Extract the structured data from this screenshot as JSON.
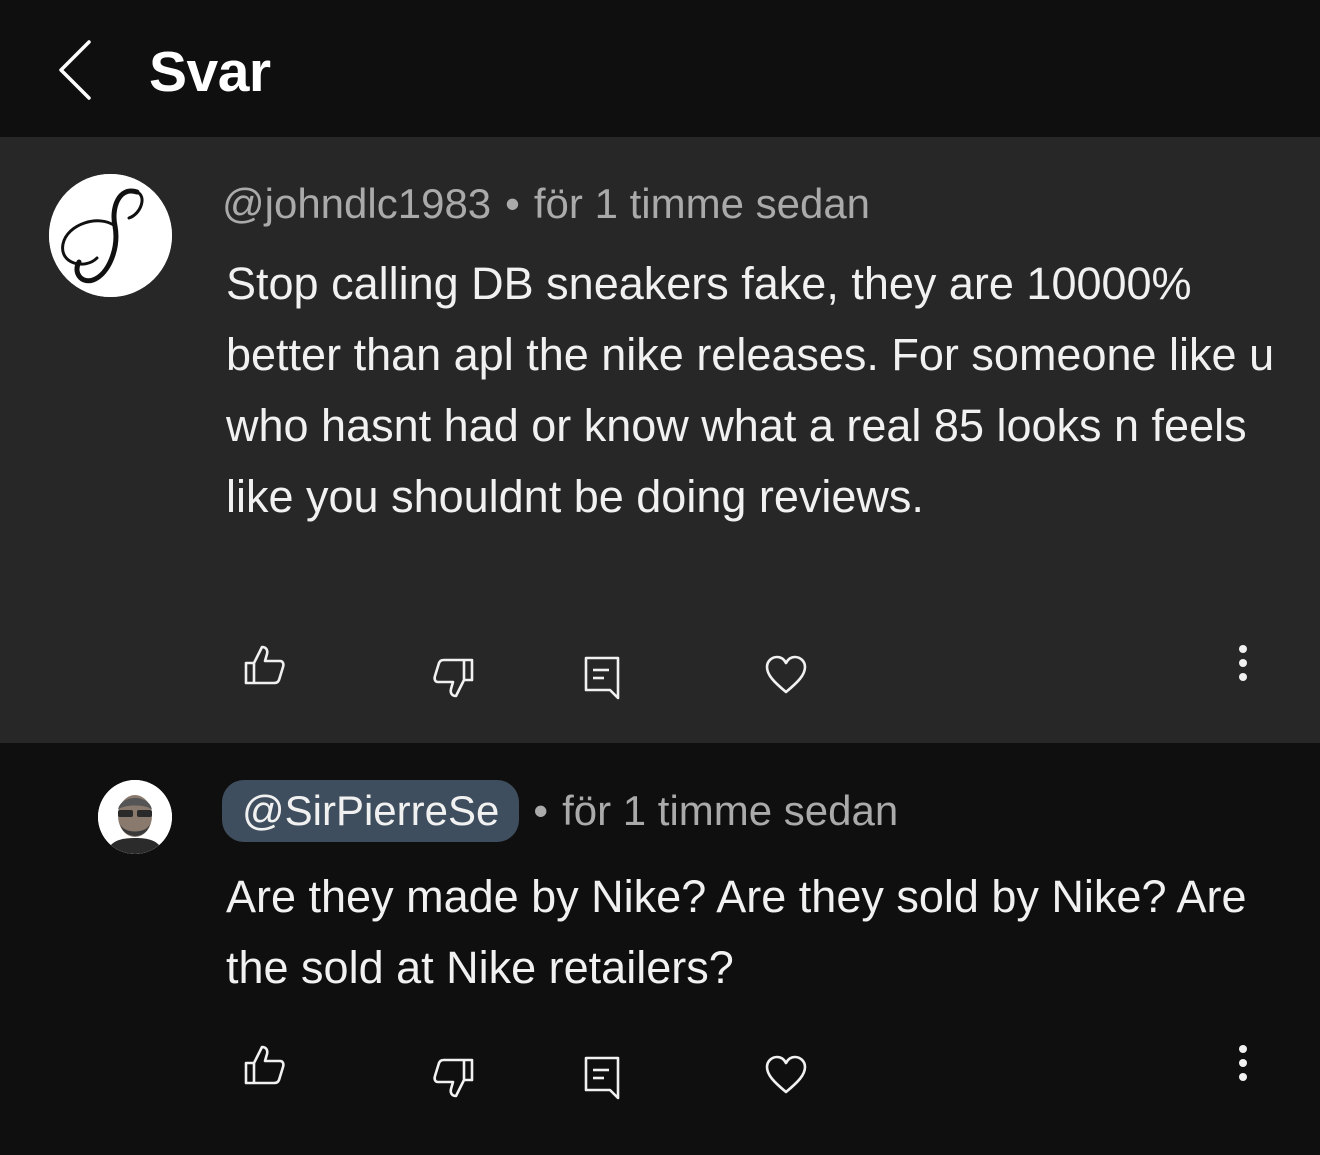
{
  "header": {
    "title": "Svar",
    "back_icon": "chevron-left-icon"
  },
  "comments": [
    {
      "handle": "@johndlc1983",
      "time": "för 1 timme sedan",
      "separator": "•",
      "text": "Stop calling DB sneakers fake, they are 10000% better than apl the nike releases. For someone like u who hasnt had or  know what a real 85 looks n feels like you shouldnt be doing reviews.",
      "avatar_icon": "script-letter-avatar-icon",
      "actions": [
        "like-icon",
        "dislike-icon",
        "reply-icon",
        "heart-icon",
        "more-vert-icon"
      ]
    },
    {
      "handle": "@SirPierreSe",
      "time": "för 1 timme sedan",
      "separator": "•",
      "text": "Are they made by Nike? Are they sold by Nike? Are the sold at Nike retailers?",
      "avatar_icon": "person-photo-avatar-icon",
      "actions": [
        "like-icon",
        "dislike-icon",
        "reply-icon",
        "heart-icon",
        "more-vert-icon"
      ]
    }
  ],
  "colors": {
    "background": "#0f0f0f",
    "highlight_background": "#272727",
    "meta_text": "#aaaaaa",
    "body_text": "#f1f1f1",
    "handle_chip": "#3f4e5e"
  }
}
